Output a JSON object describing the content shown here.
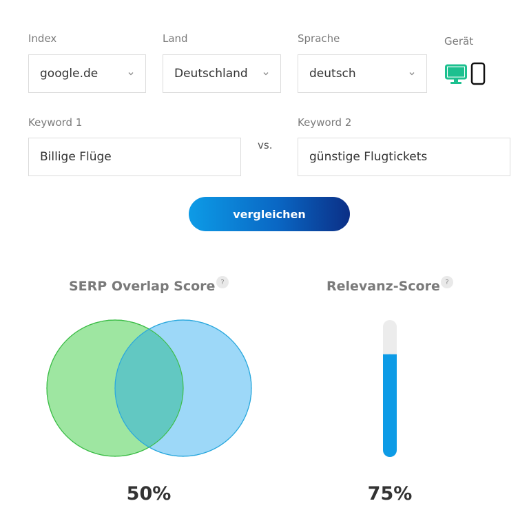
{
  "filters": {
    "index": {
      "label": "Index",
      "value": "google.de"
    },
    "land": {
      "label": "Land",
      "value": "Deutschland"
    },
    "sprache": {
      "label": "Sprache",
      "value": "deutsch"
    },
    "geraet": {
      "label": "Gerät",
      "selected": "desktop",
      "options": [
        "desktop-icon",
        "smartphone-icon"
      ]
    }
  },
  "keywords": {
    "keyword1": {
      "label": "Keyword 1",
      "value": "Billige Flüge"
    },
    "vs": "vs.",
    "keyword2": {
      "label": "Keyword 2",
      "value": "günstige Flugtickets"
    }
  },
  "compare_button": {
    "label": "vergleichen"
  },
  "serp_overlap": {
    "title": "SERP Overlap Score",
    "help": "?",
    "value_text": "50%",
    "value": 50
  },
  "relevanz": {
    "title": "Relevanz-Score",
    "help": "?",
    "value_text": "75%",
    "value": 75
  },
  "colors": {
    "accent": "#1cc08f",
    "blue": "#0d9be6",
    "circle_left": "#9ee6a1",
    "circle_right": "#9dd8f8",
    "overlap": "#62c8c2",
    "bar_fill": "#0d9be6",
    "bar_track": "#ececec"
  }
}
